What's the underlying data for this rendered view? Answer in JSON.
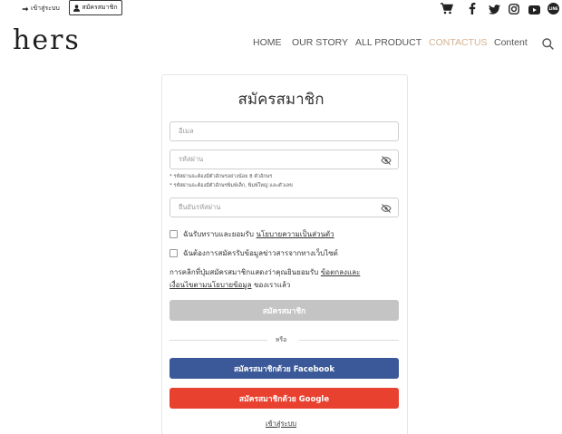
{
  "topbar": {
    "login_label": "เข้าสู่ระบบ",
    "register_label": "สมัครสมาชิก",
    "icons": [
      "cart-icon",
      "facebook-icon",
      "twitter-icon",
      "instagram-icon",
      "youtube-icon",
      "line-icon"
    ]
  },
  "header": {
    "logo": "hers",
    "nav": [
      {
        "label": "HOME"
      },
      {
        "label": "OUR STORY"
      },
      {
        "label": "ALL PRODUCT"
      },
      {
        "label": "CONTACTUS"
      },
      {
        "label": "Content"
      }
    ],
    "active_nav": "CONTACTUS",
    "accent_color": "#d4b28f"
  },
  "form": {
    "title": "สมัครสมาชิก",
    "email_placeholder": "อีเมล",
    "password_placeholder": "รหัสผ่าน",
    "password_hint_1": "* รหัสผ่านจะต้องมีตัวอักษรอย่างน้อย 8 ตัวอักษร",
    "password_hint_2": "* รหัสผ่านจะต้องมีตัวอักษรพิมพ์เล็ก, พิมพ์ใหญ่ และตัวเลข",
    "confirm_placeholder": "ยืนยันรหัสผ่าน",
    "privacy_prefix": "ฉันรับทราบและยอมรับ",
    "privacy_link": "นโยบายความเป็นส่วนตัว",
    "newsletter_label": "ฉันต้องการสมัครรับข้อมูลข่าวสารจากทางเว็บไซต์",
    "terms_prefix": "การคลิกที่ปุ่มสมัครสมาชิกแสดงว่าคุณยินยอมรับ",
    "terms_link_1": "ข้อตกลงและ",
    "terms_link_2": "เงื่อนไขตามนโยบายข้อมูล",
    "terms_suffix": "ของเราแล้ว",
    "submit_label": "สมัครสมาชิก",
    "or_label": "หรือ",
    "facebook_label": "สมัครสมาชิกด้วย Facebook",
    "google_label": "สมัครสมาชิกด้วย Google",
    "login_link": "เข้าสู่ระบบ",
    "colors": {
      "facebook": "#3b5998",
      "google": "#e8412f",
      "submit_disabled": "#c4c4c4"
    }
  }
}
